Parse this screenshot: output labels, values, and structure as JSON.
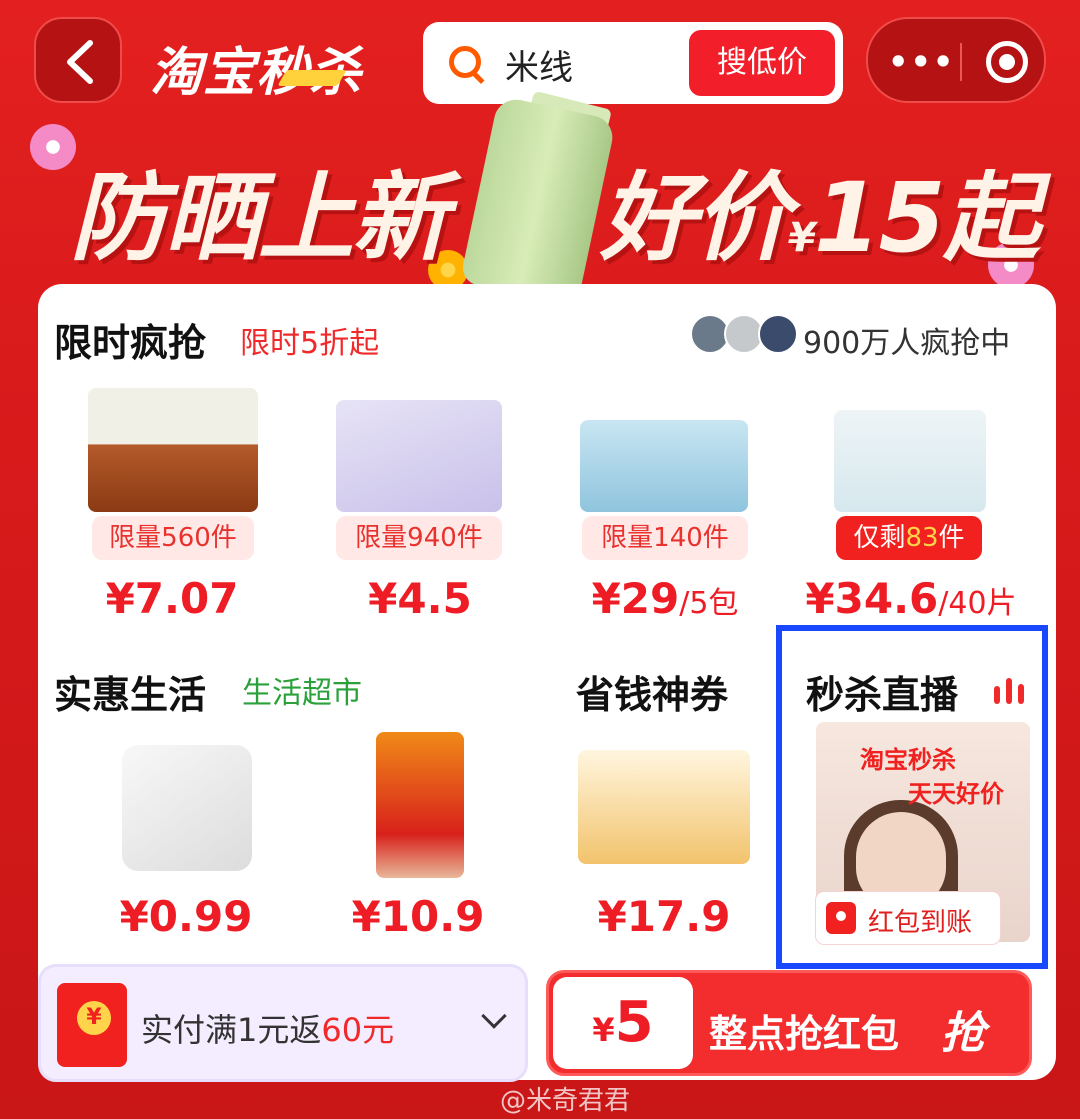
{
  "header": {
    "brand": "淘宝秒杀",
    "search_query": "米线",
    "search_button": "搜低价"
  },
  "banner": {
    "left": "防晒上新",
    "right_prefix": "好价",
    "right_currency": "¥",
    "right_amount": "15起"
  },
  "flash": {
    "title": "限时疯抢",
    "subtitle": "限时5折起",
    "hot_count": "900万人疯抢中",
    "products": [
      {
        "tag": "限量560件",
        "price": "¥7.07",
        "unit": ""
      },
      {
        "tag": "限量940件",
        "price": "¥4.5",
        "unit": ""
      },
      {
        "tag": "限量140件",
        "price": "¥29",
        "unit": "/5包"
      },
      {
        "tag_prefix": "仅剩",
        "tag_count": "83",
        "tag_suffix": "件",
        "price": "¥34.6",
        "unit": "/40片"
      }
    ]
  },
  "living": {
    "title": "实惠生活",
    "subtitle": "生活超市",
    "products": [
      {
        "price": "¥0.99"
      },
      {
        "price": "¥10.9"
      }
    ]
  },
  "coupon_section": {
    "title": "省钱神券",
    "price": "¥17.9"
  },
  "live": {
    "title": "秒杀直播",
    "overlay1": "淘宝秒杀",
    "overlay2": "天天好价",
    "redpacket": "红包到账"
  },
  "bottom": {
    "coupon_text_prefix": "实付满1元返",
    "coupon_text_amount": "60元",
    "grab_currency": "¥",
    "grab_amount": "5",
    "grab_text": "整点抢红包",
    "grab_button": "抢"
  },
  "watermark": "@米奇君君",
  "colors": {
    "accent": "#ee1c24",
    "live_border": "#1a48ff",
    "green": "#2aa13a"
  }
}
